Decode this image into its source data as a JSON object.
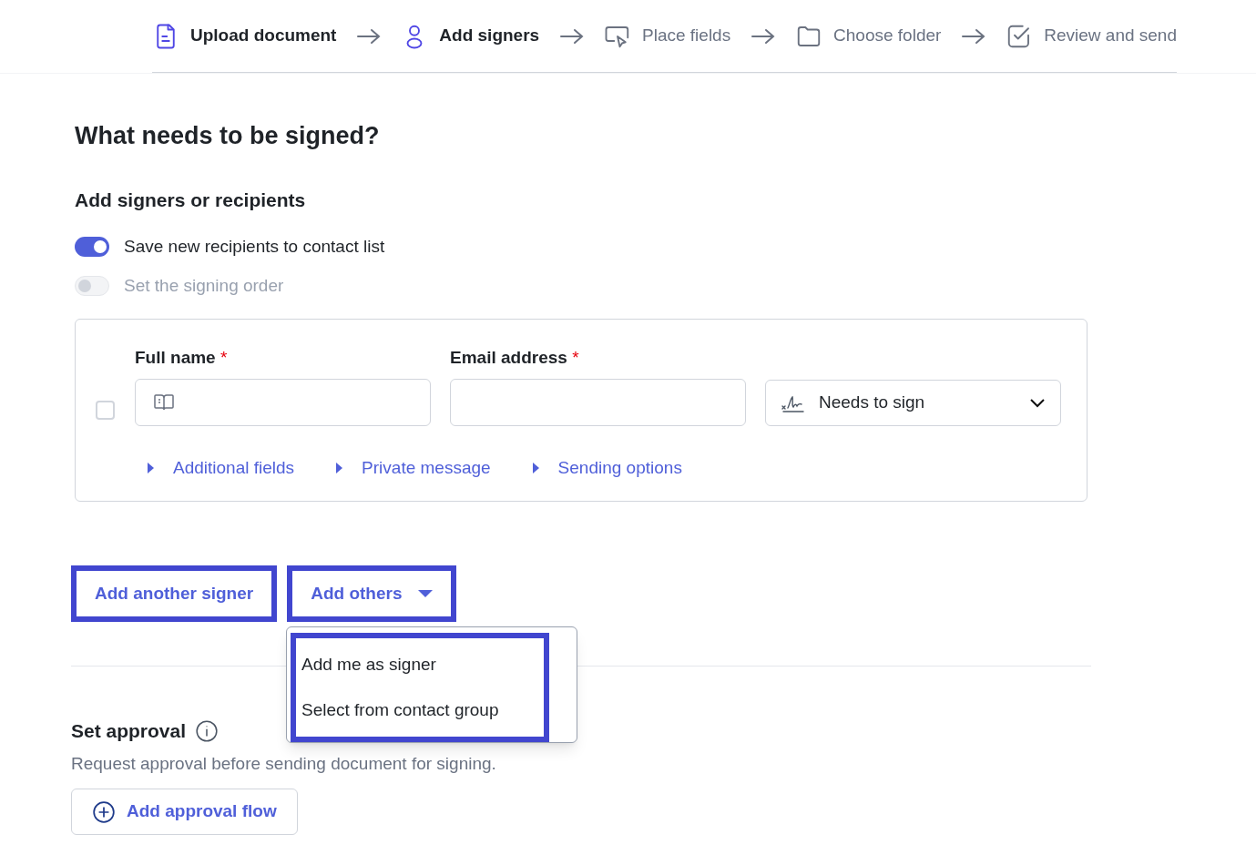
{
  "steps": [
    {
      "label": "Upload document",
      "kind": "document",
      "active": true
    },
    {
      "label": "Add signers",
      "kind": "person",
      "active": true
    },
    {
      "label": "Place fields",
      "kind": "pointer",
      "active": false
    },
    {
      "label": "Choose folder",
      "kind": "folder",
      "active": false
    },
    {
      "label": "Review and send",
      "kind": "check",
      "active": false
    }
  ],
  "title": "What needs to be signed?",
  "subtitle": "Add signers or recipients",
  "toggles": [
    {
      "label": "Save new recipients to contact list",
      "on": true,
      "disabled": false
    },
    {
      "label": "Set the signing order",
      "on": false,
      "disabled": true
    }
  ],
  "signer": {
    "checked": false,
    "fields": [
      {
        "label": "Full name",
        "required_mark": "*",
        "kind": "name"
      },
      {
        "label": "Email address",
        "required_mark": "*",
        "kind": "email"
      }
    ],
    "role": {
      "value": "Needs to sign"
    },
    "expanders": [
      {
        "label": "Additional fields",
        "expanded": false
      },
      {
        "label": "Private message",
        "expanded": false
      },
      {
        "label": "Sending options",
        "expanded": false
      }
    ]
  },
  "buttons": [
    {
      "label": "Add another signer",
      "kind": "plain",
      "highlighted": true
    },
    {
      "label": "Add others",
      "kind": "dropdown",
      "highlighted": true
    }
  ],
  "dropdown_menu": {
    "highlighted": true,
    "items": [
      "Add me as signer",
      "Select from contact group"
    ]
  },
  "approval": {
    "title": "Set approval",
    "description": "Request approval before sending document for signing.",
    "button": "Add approval flow"
  }
}
